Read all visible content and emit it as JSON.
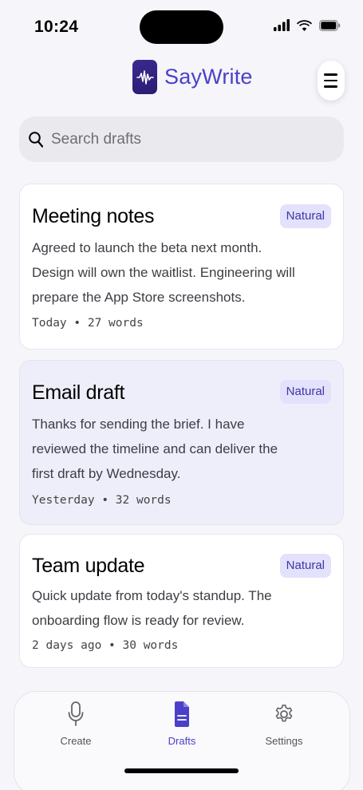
{
  "status_bar": {
    "time": "10:24"
  },
  "header": {
    "app_name": "SayWrite"
  },
  "search": {
    "placeholder": "Search drafts"
  },
  "drafts": [
    {
      "title": "Meeting notes",
      "tone": "Natural",
      "body": "Agreed to launch the beta next month. Design will own the waitlist. Engineering will prepare the App Store screenshots.",
      "date": "Today",
      "separator": "•",
      "words": "27 words"
    },
    {
      "title": "Email draft",
      "tone": "Natural",
      "body": "Thanks for sending the brief. I have reviewed the timeline and can deliver the first draft by Wednesday.",
      "date": "Yesterday",
      "separator": "•",
      "words": "32 words"
    },
    {
      "title": "Team update",
      "tone": "Natural",
      "body": "Quick update from today's standup. The onboarding flow is ready for review.",
      "date": "2 days ago",
      "separator": "•",
      "words": "30 words"
    }
  ],
  "tab_bar": {
    "tabs": [
      {
        "label": "Create",
        "icon": "microphone-icon"
      },
      {
        "label": "Drafts",
        "icon": "document-icon",
        "active": true
      },
      {
        "label": "Settings",
        "icon": "gear-icon"
      }
    ]
  },
  "colors": {
    "accent": "#4b40c8",
    "badge_bg": "#e3e1fb",
    "selected_card_bg": "#eeeefb",
    "background": "#f5f5fa"
  }
}
